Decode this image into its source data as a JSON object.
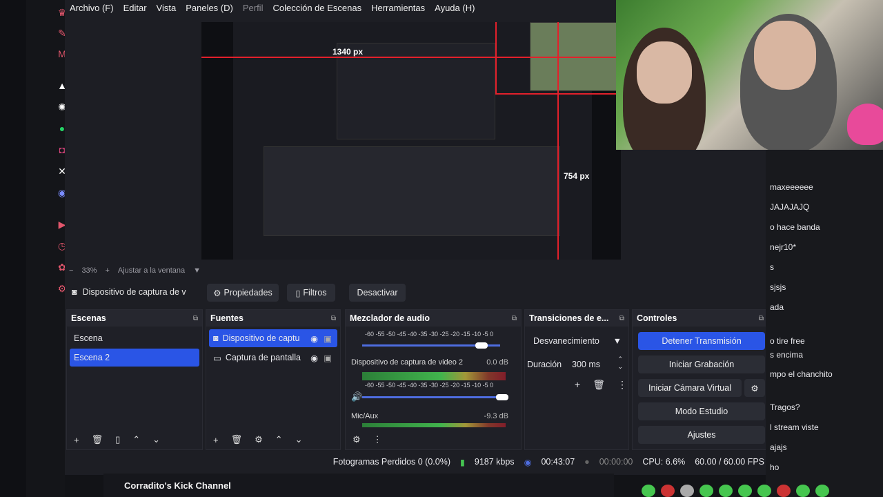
{
  "menu": {
    "items": [
      "Archivo (F)",
      "Editar",
      "Vista",
      "Paneles (D)",
      "Perfil",
      "Colección de Escenas",
      "Herramientas",
      "Ayuda (H)"
    ]
  },
  "preview": {
    "label_width": "1340 px",
    "label_height": "754 px"
  },
  "zoombar": {
    "zoom": "33%",
    "fit": "Ajustar a la ventana"
  },
  "source_toolbar": {
    "source_name": "Dispositivo de captura de v",
    "properties": "Propiedades",
    "filters": "Filtros",
    "deactivate": "Desactivar"
  },
  "scenes": {
    "title": "Escenas",
    "items": [
      {
        "label": "Escena",
        "selected": false
      },
      {
        "label": "Escena 2",
        "selected": true
      }
    ]
  },
  "sources": {
    "title": "Fuentes",
    "items": [
      {
        "label": "Dispositivo de captu",
        "selected": true
      },
      {
        "label": "Captura de pantalla",
        "selected": false
      }
    ]
  },
  "mixer": {
    "title": "Mezclador de audio",
    "scale": "-60 -55 -50 -45 -40 -35 -30 -25 -20 -15 -10  -5   0",
    "channels": [
      {
        "name": "Dispositivo de captura de video 2",
        "db": "0.0 dB"
      },
      {
        "name": "Mic/Aux",
        "db": "-9.3 dB"
      }
    ]
  },
  "transitions": {
    "title": "Transiciones de e...",
    "selected": "Desvanecimiento",
    "duration_label": "Duración",
    "duration_value": "300 ms"
  },
  "controls": {
    "title": "Controles",
    "stop_stream": "Detener Transmisión",
    "start_recording": "Iniciar Grabación",
    "virtual_cam": "Iniciar Cámara Virtual",
    "studio_mode": "Modo Estudio",
    "settings": "Ajustes"
  },
  "status": {
    "dropped": "Fotogramas Perdidos 0 (0.0%)",
    "bitrate": "9187 kbps",
    "stream_time": "00:43:07",
    "rec_time": "00:00:00",
    "cpu": "CPU: 6.6%",
    "fps": "60.00 / 60.00 FPS"
  },
  "channel": {
    "name": "Corradito's Kick Channel"
  },
  "chat": {
    "lines": [
      "maxeeeeee",
      "JAJAJAJQ",
      "o hace banda",
      "nejr10*",
      "s",
      "sjsjs",
      "ada",
      "o tire free",
      "s encima",
      "mpo el chanchito",
      "Tragos?",
      "l stream viste",
      "ajajs",
      "ho"
    ]
  },
  "colors": {
    "accent": "#2a55e6",
    "background": "#1d1e24",
    "marker": "#e3202b"
  }
}
